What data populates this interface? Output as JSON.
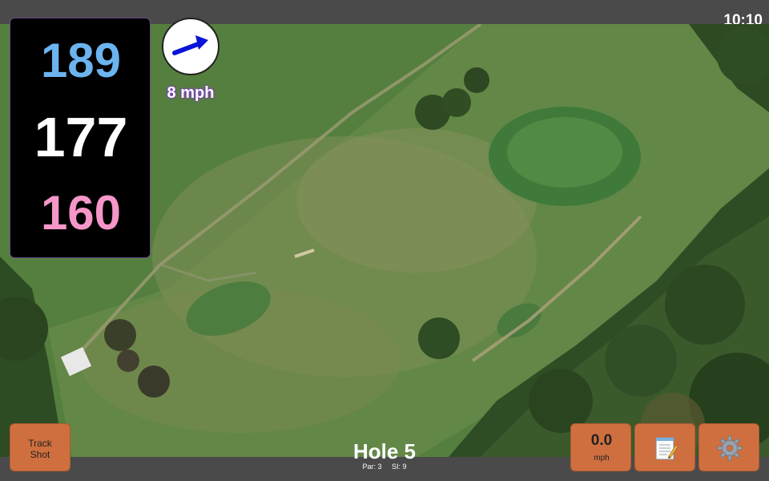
{
  "status": {
    "time": "10:10"
  },
  "distances": {
    "back": "189",
    "middle": "177",
    "front": "160"
  },
  "wind": {
    "speed": "8 mph",
    "icon": "wind-arrow-icon"
  },
  "buttons": {
    "track_shot": "Track\nShot",
    "speed_value": "0.0",
    "speed_unit": "mph",
    "notes_icon": "notepad-icon",
    "settings_icon": "gear-icon"
  },
  "hole": {
    "title": "Hole 5",
    "par": "Par: 3",
    "si": "SI: 9"
  },
  "colors": {
    "back": "#6cb4f0",
    "middle": "#ffffff",
    "front": "#f596c8",
    "button": "#cf6f3f",
    "wind_arrow": "#0a14d8"
  }
}
